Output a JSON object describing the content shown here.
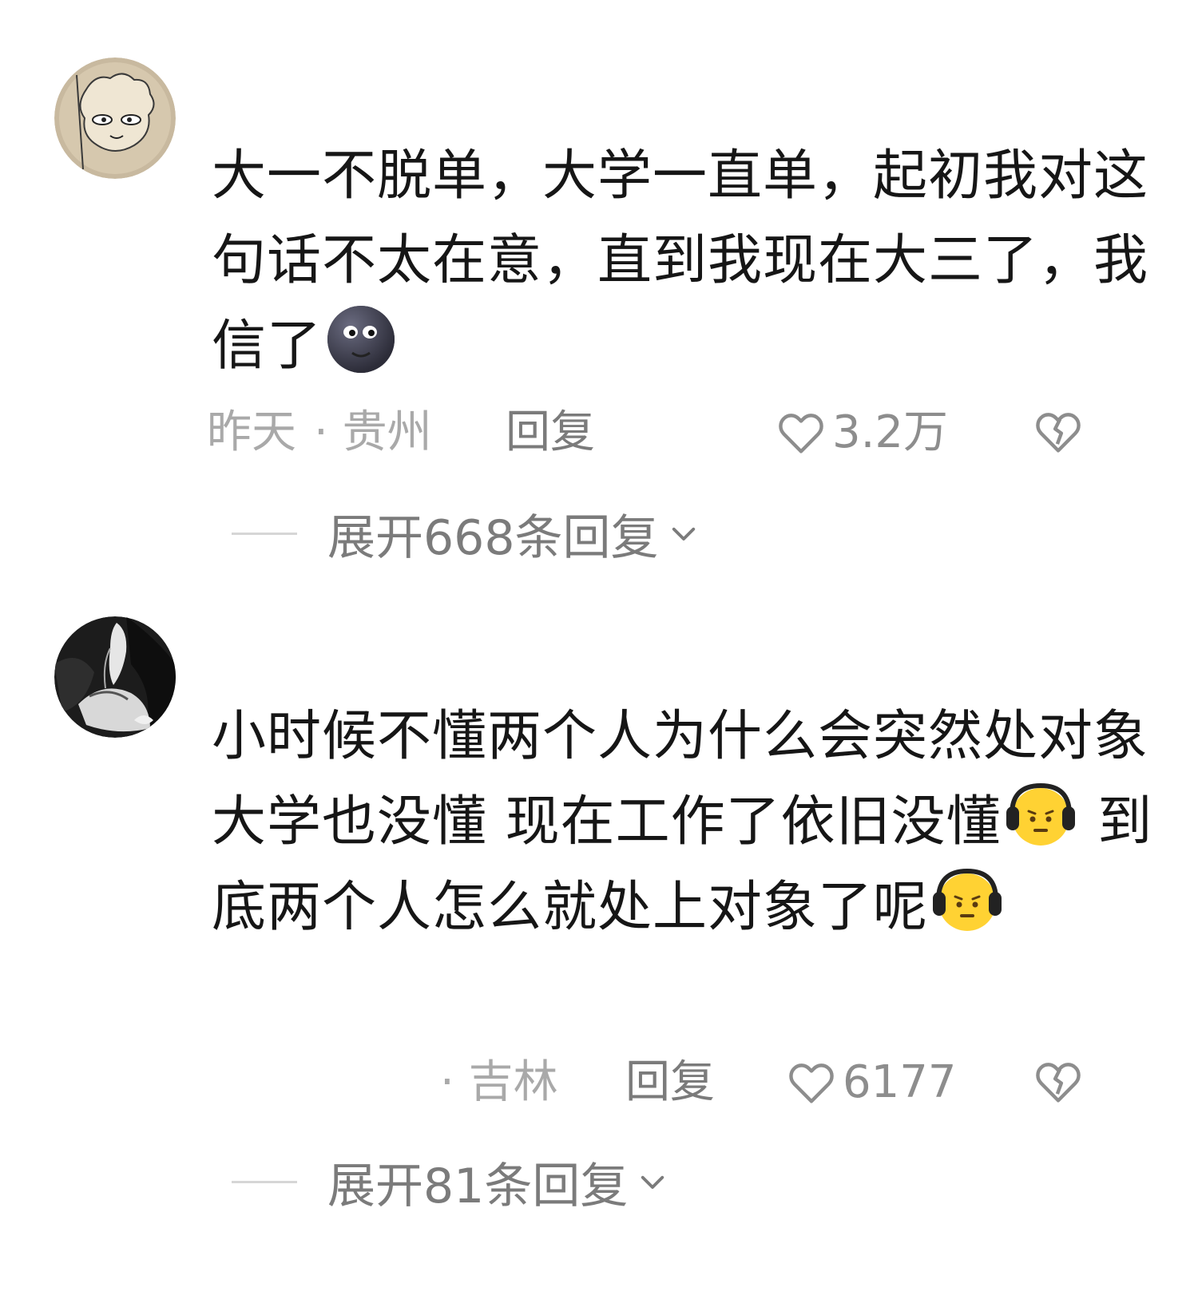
{
  "comments": [
    {
      "text_parts": [
        "大一不脱单，大学一直单，起初我对这句话不太在意，直到我现在大三了，我信了"
      ],
      "emoji": "new-moon-face-emoji",
      "date": "昨天",
      "location": "· 贵州",
      "reply_label": "回复",
      "likes": "3.2万",
      "expand_label": "展开668条回复"
    },
    {
      "text_parts": [
        "小时候不懂两个人为什么会突然处对象 大学也没懂 现在工作了依旧没懂",
        " 到底两个人怎么就处上对象了呢"
      ],
      "emoji": "frowning-headphones-face-emoji",
      "date": "",
      "location": "· 吉林",
      "reply_label": "回复",
      "likes": "6177",
      "expand_label": "展开81条回复"
    }
  ],
  "colors": {
    "text": "#161616",
    "meta": "#a9a9a9",
    "reply": "#7b7b7b",
    "divider": "#d6d6d6"
  }
}
